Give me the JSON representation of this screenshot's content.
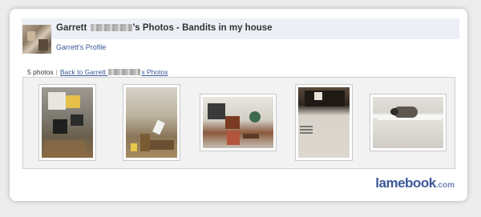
{
  "header": {
    "title_first": "Garrett",
    "title_rest": "'s Photos - Bandits in my house",
    "profile_link": "Garrett's Profile"
  },
  "meta": {
    "photo_count": "5 photos",
    "separator": "|",
    "back_link_prefix": "Back to Garrett",
    "back_link_suffix": "s Photos"
  },
  "photos": [
    {
      "subject": "ransacked room with appliances and debris on floor"
    },
    {
      "subject": "debris and broken items scattered on floor"
    },
    {
      "subject": "overturned furniture and clutter in corner"
    },
    {
      "subject": "hole in ceiling above vent"
    },
    {
      "subject": "raccoon on closet shelf"
    }
  ],
  "branding": {
    "logo_main": "lamebook",
    "logo_suffix": ".com",
    "color": "#3b5998"
  },
  "colors": {
    "link": "#3b5998",
    "header_bg": "#eceff5"
  }
}
